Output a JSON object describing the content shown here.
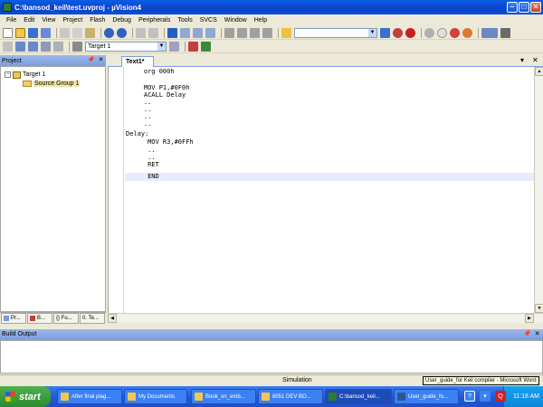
{
  "window": {
    "title": "C:\\bansod_keil\\test.uvproj - µVision4"
  },
  "menu": [
    "File",
    "Edit",
    "View",
    "Project",
    "Flash",
    "Debug",
    "Peripherals",
    "Tools",
    "SVCS",
    "Window",
    "Help"
  ],
  "toolbar2": {
    "target": "Target 1"
  },
  "project_panel": {
    "title": "Project",
    "tree": [
      {
        "label": "Target 1",
        "level": 0
      },
      {
        "label": "Source Group 1",
        "level": 1,
        "selected": true
      }
    ],
    "tabs": [
      "Pr...",
      "B...",
      "{} Fu...",
      "0. Te..."
    ]
  },
  "editor": {
    "tab": "Text1*",
    "lines": [
      "    org 000h",
      "",
      "    MOV P1,#0F0h",
      "    ACALL Delay",
      "    ..",
      "    ..",
      "    ..",
      "    ..",
      "Delay:",
      "     MOV R3,#0FFh",
      "     ..",
      "     ..",
      "     RET",
      "",
      "     END"
    ],
    "current_line_index": 14
  },
  "build_output": {
    "title": "Build Output"
  },
  "status": {
    "mode": "Simulation",
    "tooltip": "User_guide_for Keil compiler - Microsoft Word"
  },
  "taskbar": {
    "start": "start",
    "tasks": [
      "After final plag...",
      "My Documents",
      "Book_on_emb...",
      "8051 DEV BO...",
      "C:\\bansod_keil...",
      "User_guide_fo..."
    ],
    "clock": "11:18 AM"
  },
  "colors": {
    "title_bar": "#0a4fdc",
    "panel_header": "#9db9eb",
    "current_line": "#e8ecfc",
    "taskbar": "#235ad8",
    "start": "#2e8a2e"
  }
}
